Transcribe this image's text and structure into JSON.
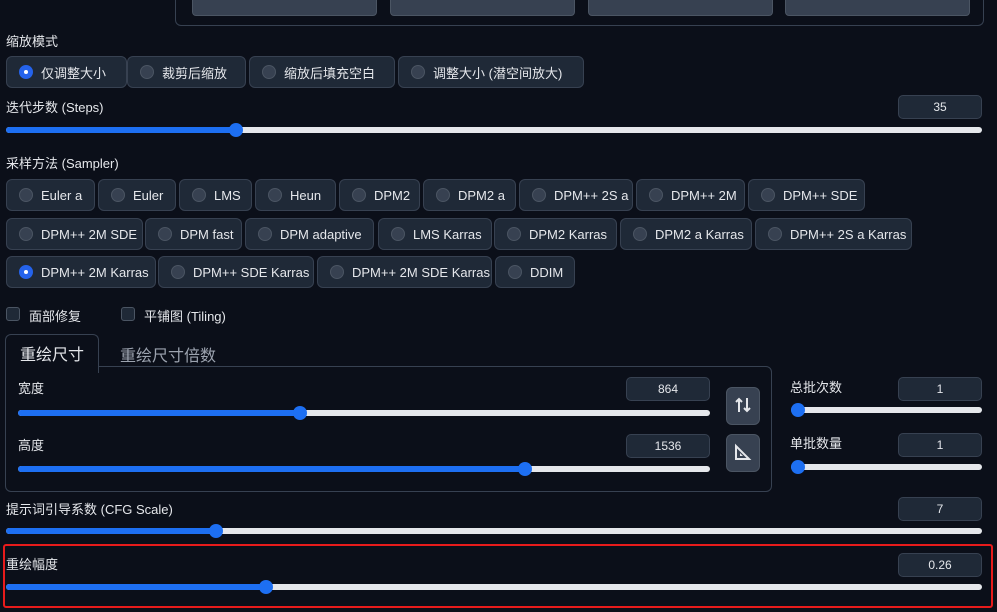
{
  "resize_mode": {
    "label": "缩放模式",
    "options": [
      "仅调整大小",
      "裁剪后缩放",
      "缩放后填充空白",
      "调整大小 (潜空间放大)"
    ],
    "selected": "仅调整大小"
  },
  "steps": {
    "label": "迭代步数 (Steps)",
    "value": "35",
    "fraction": 0.232
  },
  "sampler": {
    "label": "采样方法 (Sampler)",
    "options": [
      "Euler a",
      "Euler",
      "LMS",
      "Heun",
      "DPM2",
      "DPM2 a",
      "DPM++ 2S a",
      "DPM++ 2M",
      "DPM++ SDE",
      "DPM++ 2M SDE",
      "DPM fast",
      "DPM adaptive",
      "LMS Karras",
      "DPM2 Karras",
      "DPM2 a Karras",
      "DPM++ 2S a Karras",
      "DPM++ 2M Karras",
      "DPM++ SDE Karras",
      "DPM++ 2M SDE Karras",
      "DDIM"
    ],
    "selected": "DPM++ 2M Karras"
  },
  "checkboxes": {
    "face_restore": "面部修复",
    "tiling": "平铺图 (Tiling)"
  },
  "tabs": {
    "resize_to": "重绘尺寸",
    "resize_by": "重绘尺寸倍数"
  },
  "width": {
    "label": "宽度",
    "value": "864",
    "fraction": 0.406
  },
  "height": {
    "label": "高度",
    "value": "1536",
    "fraction": 0.737
  },
  "batch_count": {
    "label": "总批次数",
    "value": "1",
    "fraction": 0.0
  },
  "batch_size": {
    "label": "单批数量",
    "value": "1",
    "fraction": 0.0
  },
  "cfg_scale": {
    "label": "提示词引导系数 (CFG Scale)",
    "value": "7",
    "fraction": 0.211
  },
  "denoising": {
    "label": "重绘幅度",
    "value": "0.26",
    "fraction": 0.263
  },
  "icons": {
    "swap": "swap-dimensions-icon",
    "ruler": "triangle-ruler-icon"
  },
  "colors": {
    "accent": "#1d6ff2",
    "highlight": "#e81b1b",
    "background": "#0b0f19"
  }
}
